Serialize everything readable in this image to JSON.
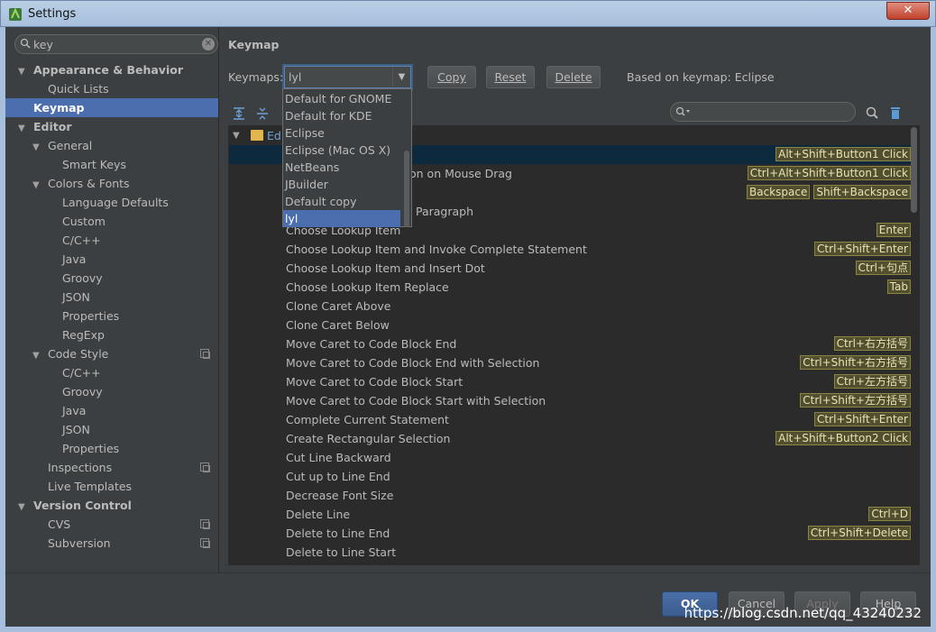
{
  "window": {
    "title": "Settings",
    "close_label": "✕"
  },
  "search": {
    "value": "key"
  },
  "sidebar": {
    "items": [
      {
        "label": "Appearance & Behavior",
        "level": 0,
        "arrow": "▼",
        "bold": true
      },
      {
        "label": "Quick Lists",
        "level": 1
      },
      {
        "label": "Keymap",
        "level": 0,
        "bold": true,
        "selected": true
      },
      {
        "label": "Editor",
        "level": 0,
        "arrow": "▼",
        "bold": true
      },
      {
        "label": "General",
        "level": 1,
        "arrow": "▼"
      },
      {
        "label": "Smart Keys",
        "level": 2
      },
      {
        "label": "Colors & Fonts",
        "level": 1,
        "arrow": "▼"
      },
      {
        "label": "Language Defaults",
        "level": 2
      },
      {
        "label": "Custom",
        "level": 2
      },
      {
        "label": "C/C++",
        "level": 2
      },
      {
        "label": "Java",
        "level": 2
      },
      {
        "label": "Groovy",
        "level": 2
      },
      {
        "label": "JSON",
        "level": 2
      },
      {
        "label": "Properties",
        "level": 2
      },
      {
        "label": "RegExp",
        "level": 2
      },
      {
        "label": "Code Style",
        "level": 1,
        "arrow": "▼",
        "project": true
      },
      {
        "label": "C/C++",
        "level": 2
      },
      {
        "label": "Groovy",
        "level": 2
      },
      {
        "label": "Java",
        "level": 2
      },
      {
        "label": "JSON",
        "level": 2
      },
      {
        "label": "Properties",
        "level": 2
      },
      {
        "label": "Inspections",
        "level": 1,
        "project": true
      },
      {
        "label": "Live Templates",
        "level": 1
      },
      {
        "label": "Version Control",
        "level": 0,
        "arrow": "▼",
        "bold": true
      },
      {
        "label": "CVS",
        "level": 1,
        "project": true
      },
      {
        "label": "Subversion",
        "level": 1,
        "project": true
      }
    ]
  },
  "main": {
    "title": "Keymap",
    "keymaps_label": "Keymaps:",
    "keymap_value": "lyl",
    "copy_label": "Copy",
    "reset_label": "Reset",
    "delete_label": "Delete",
    "based_on": "Based on keymap: Eclipse",
    "tree_root_label": "Ed"
  },
  "dropdown": {
    "options": [
      "Default for GNOME",
      "Default for KDE",
      "Eclipse",
      "Eclipse (Mac OS X)",
      "NetBeans",
      "JBuilder",
      "Default copy",
      "lyl"
    ],
    "selected": "lyl"
  },
  "actions": [
    {
      "label": "",
      "shortcuts": [
        "Alt+Shift+Button1 Click"
      ],
      "selected": true
    },
    {
      "label": "on on Mouse Drag",
      "shortcuts": [
        "Ctrl+Alt+Shift+Button1 Click"
      ],
      "offset": true
    },
    {
      "label": "",
      "shortcuts": [
        "Backspace",
        "Shift+Backspace"
      ]
    },
    {
      "label": "Paragraph",
      "shortcuts": [],
      "offset2": true
    },
    {
      "label": "Choose Lookup Item",
      "shortcuts": [
        "Enter"
      ]
    },
    {
      "label": "Choose Lookup Item and Invoke Complete Statement",
      "shortcuts": [
        "Ctrl+Shift+Enter"
      ]
    },
    {
      "label": "Choose Lookup Item and Insert Dot",
      "shortcuts": [
        "Ctrl+句点"
      ]
    },
    {
      "label": "Choose Lookup Item Replace",
      "shortcuts": [
        "Tab"
      ]
    },
    {
      "label": "Clone Caret Above",
      "shortcuts": []
    },
    {
      "label": "Clone Caret Below",
      "shortcuts": []
    },
    {
      "label": "Move Caret to Code Block End",
      "shortcuts": [
        "Ctrl+右方括号"
      ]
    },
    {
      "label": "Move Caret to Code Block End with Selection",
      "shortcuts": [
        "Ctrl+Shift+右方括号"
      ]
    },
    {
      "label": "Move Caret to Code Block Start",
      "shortcuts": [
        "Ctrl+左方括号"
      ]
    },
    {
      "label": "Move Caret to Code Block Start with Selection",
      "shortcuts": [
        "Ctrl+Shift+左方括号"
      ]
    },
    {
      "label": "Complete Current Statement",
      "shortcuts": [
        "Ctrl+Shift+Enter"
      ]
    },
    {
      "label": "Create Rectangular Selection",
      "shortcuts": [
        "Alt+Shift+Button2 Click"
      ]
    },
    {
      "label": "Cut Line Backward",
      "shortcuts": []
    },
    {
      "label": "Cut up to Line End",
      "shortcuts": []
    },
    {
      "label": "Decrease Font Size",
      "shortcuts": []
    },
    {
      "label": "Delete Line",
      "shortcuts": [
        "Ctrl+D"
      ]
    },
    {
      "label": "Delete to Line End",
      "shortcuts": [
        "Ctrl+Shift+Delete"
      ]
    },
    {
      "label": "Delete to Line Start",
      "shortcuts": []
    }
  ],
  "footer": {
    "ok_label": "OK",
    "cancel_label": "Cancel",
    "apply_label": "Apply",
    "help_label": "Help",
    "watermark": "https://blog.csdn.net/qq_43240232"
  },
  "colors": {
    "accent": "#4b6eaf",
    "shortcut_bg": "#514f2f",
    "shortcut_border": "#8c8541"
  }
}
